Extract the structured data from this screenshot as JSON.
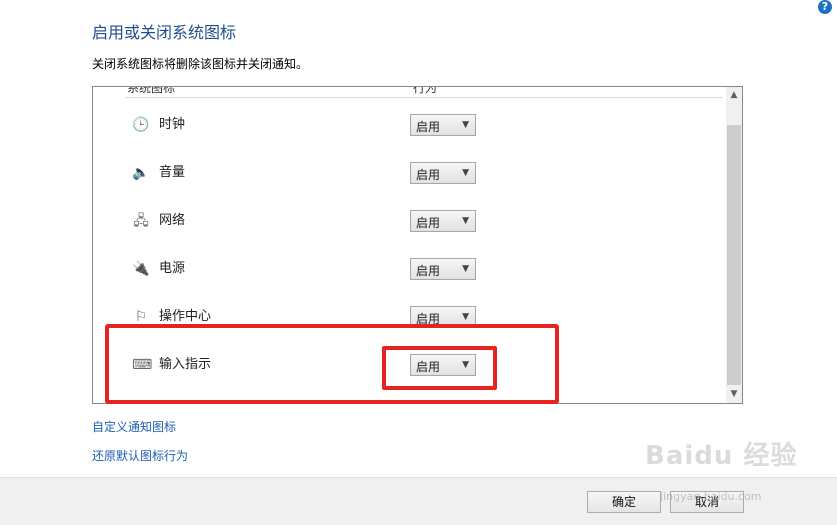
{
  "header": {
    "title": "启用或关闭系统图标",
    "subtitle": "关闭系统图标将删除该图标并关闭通知。",
    "help_icon_glyph": "?"
  },
  "table": {
    "col_name": "系统图标",
    "col_behavior": "行为",
    "rows": [
      {
        "icon": "clock-icon",
        "glyph": "🕒",
        "label": "时钟",
        "value": "启用"
      },
      {
        "icon": "volume-icon",
        "glyph": "🔈",
        "label": "音量",
        "value": "启用"
      },
      {
        "icon": "network-icon",
        "glyph": "🖧",
        "label": "网络",
        "value": "启用"
      },
      {
        "icon": "power-icon",
        "glyph": "🔌",
        "label": "电源",
        "value": "启用"
      },
      {
        "icon": "action-center-flag-icon",
        "glyph": "⚐",
        "label": "操作中心",
        "value": "启用"
      },
      {
        "icon": "keyboard-icon",
        "glyph": "⌨",
        "label": "输入指示",
        "value": "启用"
      }
    ]
  },
  "links": {
    "customize": "自定义通知图标",
    "restore": "还原默认图标行为"
  },
  "footer": {
    "ok": "确定",
    "cancel": "取消"
  },
  "watermark": {
    "brand": "Baidu 经验",
    "url": "jingyan.baidu.com"
  },
  "colors": {
    "title": "#1e4e8c",
    "link": "#1e5fb4",
    "highlight": "#e8231f"
  }
}
